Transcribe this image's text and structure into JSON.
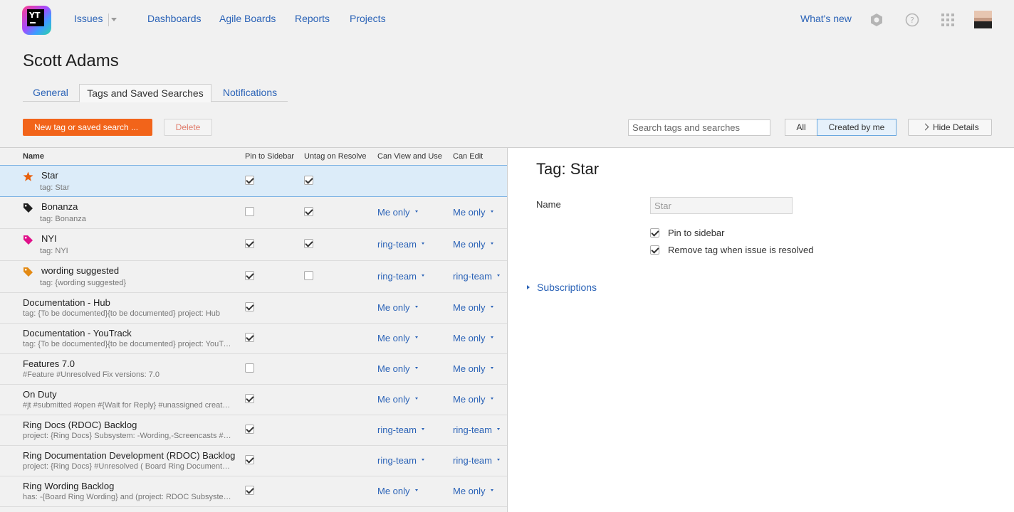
{
  "header": {
    "logo_text": "YT",
    "nav": [
      "Issues",
      "Dashboards",
      "Agile Boards",
      "Reports",
      "Projects"
    ],
    "whats_new": "What's new",
    "icons": [
      "settings-icon",
      "help-icon",
      "apps-grid-icon"
    ]
  },
  "page": {
    "title": "Scott Adams",
    "tabs": [
      "General",
      "Tags and Saved Searches",
      "Notifications"
    ],
    "active_tab": "Tags and Saved Searches"
  },
  "toolbar": {
    "new_label": "New tag or saved search ...",
    "delete_label": "Delete",
    "search_placeholder": "Search tags and searches",
    "filter_all": "All",
    "filter_mine": "Created by me",
    "hide_details": "Hide Details"
  },
  "table": {
    "columns": [
      "Name",
      "Pin to Sidebar",
      "Untag on Resolve",
      "Can View and Use",
      "Can Edit"
    ],
    "rows": [
      {
        "name": "Star",
        "sub": "tag: Star",
        "icon": "star-icon",
        "icon_color": "#e8600d",
        "pin": true,
        "untag": true,
        "view": "",
        "edit": "",
        "selected": true
      },
      {
        "name": "Bonanza",
        "sub": "tag: Bonanza",
        "icon": "tag-icon",
        "icon_color": "#1f1f1f",
        "pin": false,
        "untag": true,
        "view": "Me only",
        "edit": "Me only"
      },
      {
        "name": "NYI",
        "sub": "tag: NYI",
        "icon": "tag-icon",
        "icon_color": "#e0118a",
        "pin": true,
        "untag": true,
        "view": "ring-team",
        "edit": "Me only"
      },
      {
        "name": "wording suggested",
        "sub": "tag: {wording suggested}",
        "icon": "tag-icon",
        "icon_color": "#e38a14",
        "pin": true,
        "untag": false,
        "view": "ring-team",
        "edit": "ring-team"
      },
      {
        "name": "Documentation - Hub",
        "sub": "tag: {To be documented}{to be documented} project: Hub",
        "pin": true,
        "view": "Me only",
        "edit": "Me only"
      },
      {
        "name": "Documentation - YouTrack",
        "sub": "tag: {To be documented}{to be documented} project: YouTrack",
        "pin": true,
        "view": "Me only",
        "edit": "Me only"
      },
      {
        "name": "Features 7.0",
        "sub": "#Feature #Unresolved Fix versions: 7.0",
        "pin": false,
        "view": "Me only",
        "edit": "Me only"
      },
      {
        "name": "On Duty",
        "sub": "#jt #submitted #open #{Wait for Reply} #unassigned created: Today",
        "pin": true,
        "view": "Me only",
        "edit": "Me only"
      },
      {
        "name": "Ring Docs (RDOC) Backlog",
        "sub": "project: {Ring Docs} Subsystem: -Wording,-Screencasts #Unresolved",
        "pin": true,
        "view": "ring-team",
        "edit": "ring-team"
      },
      {
        "name": "Ring Documentation Development (RDOC) Backlog",
        "sub": "project: {Ring Docs} #Unresolved ( Board Ring Documentation )",
        "pin": true,
        "view": "ring-team",
        "edit": "ring-team"
      },
      {
        "name": "Ring Wording Backlog",
        "sub": "has: -{Board Ring Wording} and (project: RDOC Subsystem: Wording)",
        "pin": true,
        "view": "Me only",
        "edit": "Me only"
      }
    ]
  },
  "details": {
    "title": "Tag: Star",
    "name_label": "Name",
    "name_value": "Star",
    "pin_label": "Pin to sidebar",
    "pin_checked": true,
    "remove_label": "Remove tag when issue is resolved",
    "remove_checked": true,
    "subscriptions": "Subscriptions"
  }
}
